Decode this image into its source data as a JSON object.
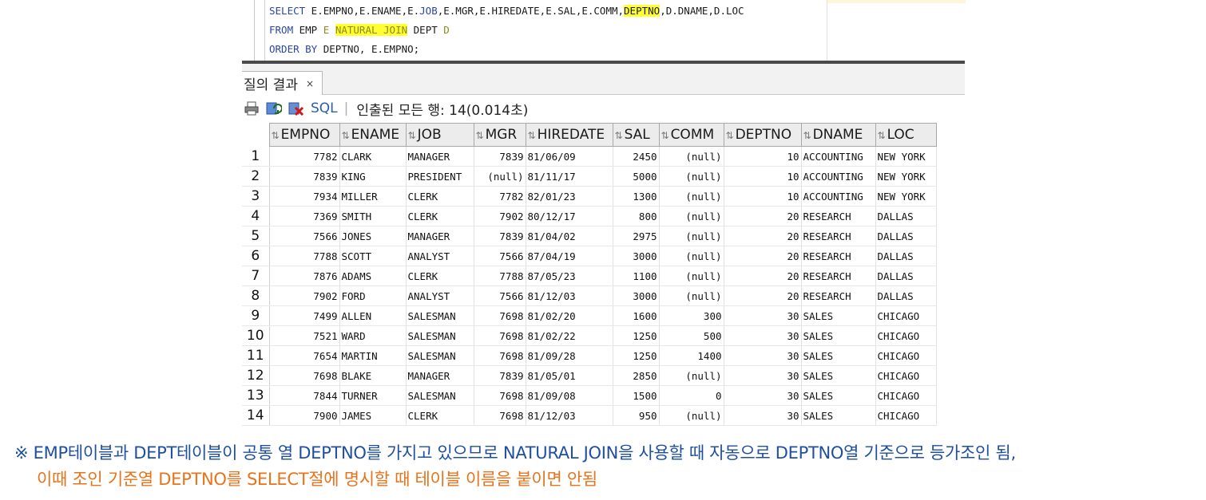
{
  "editor": {
    "line1": {
      "select": "SELECT",
      "mid1": " E.EMPNO,E.ENAME,E.",
      "job": "JOB",
      "mid2": ",E.MGR,E.HIREDATE,E.SAL,E.COMM,",
      "deptno": "DEPTNO",
      "mid3": ",D.DNAME,D.LOC"
    },
    "line2": {
      "from": "FROM",
      "mid1": " EMP ",
      "alias_e": "E",
      "sp": " ",
      "natural_join": "NATURAL JOIN",
      "mid2": " DEPT ",
      "alias_d": "D"
    },
    "line3": {
      "order_by": "ORDER BY",
      "rest": " DEPTNO, E.EMPNO;"
    }
  },
  "tab": {
    "label": "질의 결과",
    "close": "×"
  },
  "toolbar": {
    "sql_label": "SQL",
    "separator": "|",
    "status": "인출된 모든 행: 14(0.014초)"
  },
  "grid": {
    "columns": [
      "EMPNO",
      "ENAME",
      "JOB",
      "MGR",
      "HIREDATE",
      "SAL",
      "COMM",
      "DEPTNO",
      "DNAME",
      "LOC"
    ],
    "rows": [
      [
        "1",
        "7782",
        "CLARK",
        "MANAGER",
        "7839",
        "81/06/09",
        "2450",
        "(null)",
        "10",
        "ACCOUNTING",
        "NEW YORK"
      ],
      [
        "2",
        "7839",
        "KING",
        "PRESIDENT",
        "(null)",
        "81/11/17",
        "5000",
        "(null)",
        "10",
        "ACCOUNTING",
        "NEW YORK"
      ],
      [
        "3",
        "7934",
        "MILLER",
        "CLERK",
        "7782",
        "82/01/23",
        "1300",
        "(null)",
        "10",
        "ACCOUNTING",
        "NEW YORK"
      ],
      [
        "4",
        "7369",
        "SMITH",
        "CLERK",
        "7902",
        "80/12/17",
        "800",
        "(null)",
        "20",
        "RESEARCH",
        "DALLAS"
      ],
      [
        "5",
        "7566",
        "JONES",
        "MANAGER",
        "7839",
        "81/04/02",
        "2975",
        "(null)",
        "20",
        "RESEARCH",
        "DALLAS"
      ],
      [
        "6",
        "7788",
        "SCOTT",
        "ANALYST",
        "7566",
        "87/04/19",
        "3000",
        "(null)",
        "20",
        "RESEARCH",
        "DALLAS"
      ],
      [
        "7",
        "7876",
        "ADAMS",
        "CLERK",
        "7788",
        "87/05/23",
        "1100",
        "(null)",
        "20",
        "RESEARCH",
        "DALLAS"
      ],
      [
        "8",
        "7902",
        "FORD",
        "ANALYST",
        "7566",
        "81/12/03",
        "3000",
        "(null)",
        "20",
        "RESEARCH",
        "DALLAS"
      ],
      [
        "9",
        "7499",
        "ALLEN",
        "SALESMAN",
        "7698",
        "81/02/20",
        "1600",
        "300",
        "30",
        "SALES",
        "CHICAGO"
      ],
      [
        "10",
        "7521",
        "WARD",
        "SALESMAN",
        "7698",
        "81/02/22",
        "1250",
        "500",
        "30",
        "SALES",
        "CHICAGO"
      ],
      [
        "11",
        "7654",
        "MARTIN",
        "SALESMAN",
        "7698",
        "81/09/28",
        "1250",
        "1400",
        "30",
        "SALES",
        "CHICAGO"
      ],
      [
        "12",
        "7698",
        "BLAKE",
        "MANAGER",
        "7839",
        "81/05/01",
        "2850",
        "(null)",
        "30",
        "SALES",
        "CHICAGO"
      ],
      [
        "13",
        "7844",
        "TURNER",
        "SALESMAN",
        "7698",
        "81/09/08",
        "1500",
        "0",
        "30",
        "SALES",
        "CHICAGO"
      ],
      [
        "14",
        "7900",
        "JAMES",
        "CLERK",
        "7698",
        "81/12/03",
        "950",
        "(null)",
        "30",
        "SALES",
        "CHICAGO"
      ]
    ]
  },
  "notes": {
    "line1": "※ EMP테이블과 DEPT테이블이 공통 열 DEPTNO를 가지고 있으므로 NATURAL JOIN을 사용할 때 자동으로 DEPTNO열 기준으로 등가조인 됨,",
    "line2": "이때 조인 기준열 DEPTNO를 SELECT절에 명시할 때 테이블 이름을 붙이면 안됨"
  },
  "colors": {
    "keyword": "#2a44a8",
    "highlight": "#ffff33",
    "note_blue": "#1f4fa0",
    "note_orange": "#e8731a"
  },
  "icons": [
    "print-icon",
    "refresh-icon",
    "delete-icon",
    "sort-icon"
  ]
}
